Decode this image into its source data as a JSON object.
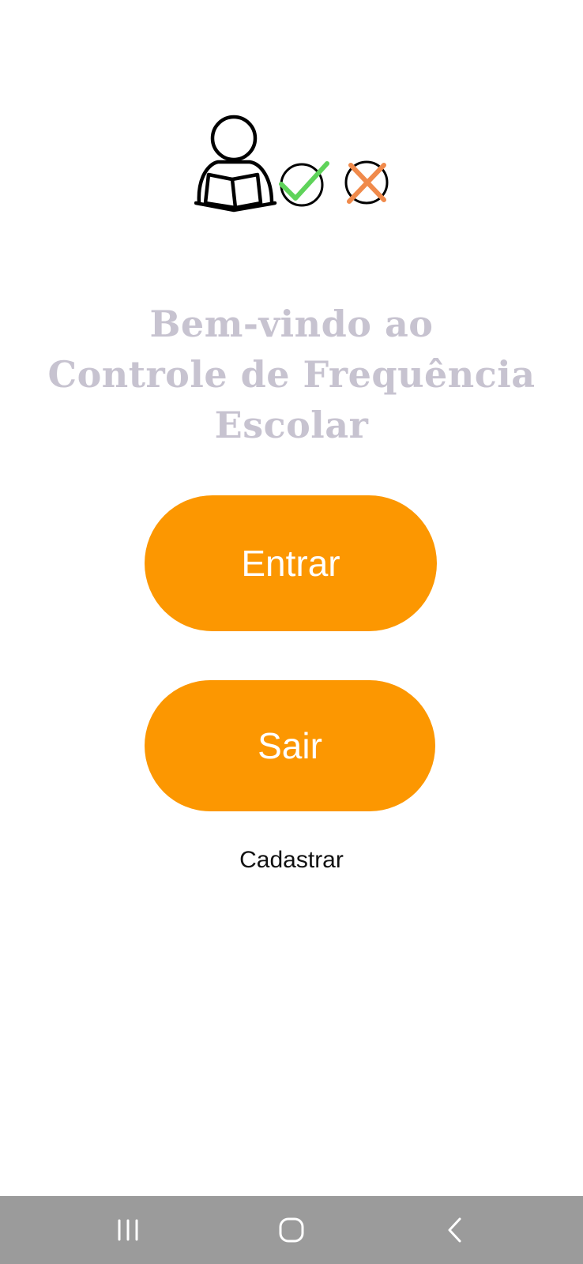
{
  "welcome": {
    "line1": "Bem-vindo ao",
    "line2": "Controle de Frequência",
    "line3": "Escolar"
  },
  "buttons": {
    "enter_label": "Entrar",
    "exit_label": "Sair"
  },
  "register_link": "Cadastrar",
  "icons": {
    "logo": [
      "student-reading-icon",
      "check-circle-icon",
      "x-circle-icon"
    ],
    "navigation": [
      "recent-apps-icon",
      "home-icon",
      "back-icon"
    ]
  },
  "colors": {
    "accent": "#fc9701",
    "title": "#c7c3d0",
    "check": "#5fd35a",
    "cross": "#f08a4b",
    "navbar": "#9b9b9b"
  }
}
